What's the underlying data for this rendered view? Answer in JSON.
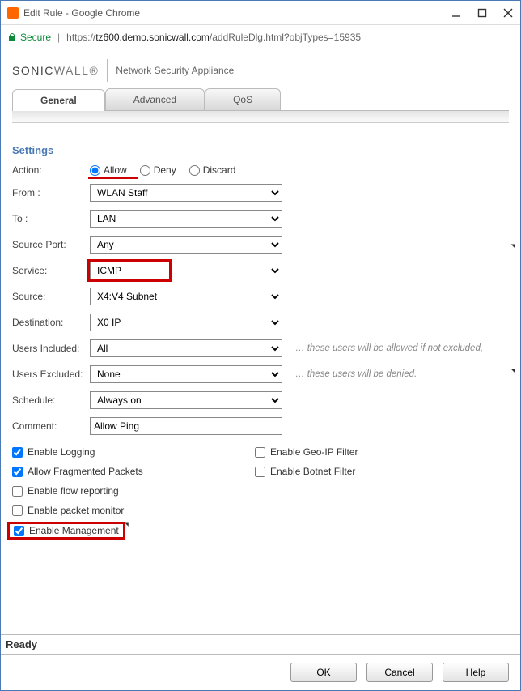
{
  "window": {
    "title": "Edit Rule - Google Chrome"
  },
  "address": {
    "secure_label": "Secure",
    "scheme": "https://",
    "host": "tz600.demo.sonicwall.com",
    "path": "/addRuleDlg.html?objTypes=15935"
  },
  "branding": {
    "brand_html_prefix": "SONIC",
    "brand_html_suffix": "WALL",
    "subtitle": "Network Security Appliance"
  },
  "tabs": [
    {
      "label": "General",
      "active": true
    },
    {
      "label": "Advanced",
      "active": false
    },
    {
      "label": "QoS",
      "active": false
    }
  ],
  "section_title": "Settings",
  "labels": {
    "action": "Action:",
    "from": "From :",
    "to": "To :",
    "source_port": "Source Port:",
    "service": "Service:",
    "source": "Source:",
    "destination": "Destination:",
    "users_included": "Users Included:",
    "users_excluded": "Users Excluded:",
    "schedule": "Schedule:",
    "comment": "Comment:"
  },
  "action": {
    "allow": "Allow",
    "deny": "Deny",
    "discard": "Discard",
    "selected": "allow"
  },
  "values": {
    "from": "WLAN Staff",
    "to": "LAN",
    "source_port": "Any",
    "service": "ICMP",
    "source": "X4:V4 Subnet",
    "destination": "X0 IP",
    "users_included": "All",
    "users_excluded": "None",
    "schedule": "Always on",
    "comment": "Allow Ping"
  },
  "notes": {
    "users_included": "… these users will be allowed if not excluded,",
    "users_excluded": "… these users will be denied."
  },
  "checks": {
    "enable_logging": "Enable Logging",
    "allow_fragmented": "Allow Fragmented Packets",
    "enable_flow_reporting": "Enable flow reporting",
    "enable_packet_monitor": "Enable packet monitor",
    "enable_management": "Enable Management",
    "enable_geoip": "Enable Geo-IP Filter",
    "enable_botnet": "Enable Botnet Filter"
  },
  "checks_state": {
    "enable_logging": true,
    "allow_fragmented": true,
    "enable_flow_reporting": false,
    "enable_packet_monitor": false,
    "enable_management": true,
    "enable_geoip": false,
    "enable_botnet": false
  },
  "statusbar": "Ready",
  "buttons": {
    "ok": "OK",
    "cancel": "Cancel",
    "help": "Help"
  }
}
